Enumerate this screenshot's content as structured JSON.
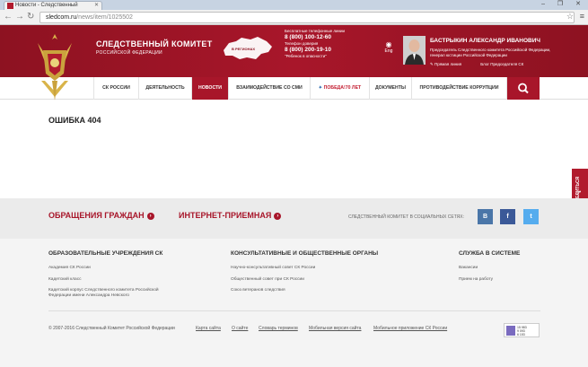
{
  "browser": {
    "tab_title": "Новости - Следственный",
    "url_host": "sledcom.ru",
    "url_path": "/news/item/1025502",
    "window_controls": "– ❐ ✕"
  },
  "header": {
    "title": "СЛЕДСТВЕННЫЙ КОМИТЕТ",
    "subtitle": "РОССИЙСКОЙ ФЕДЕРАЦИИ",
    "map_label": "В РЕГИОНАХ",
    "phones": {
      "caption1": "Бесплатные телефонные линии",
      "num1": "8 (800) 100-12-60",
      "caption2": "Телефон доверия",
      "num2": "8 (800) 200-19-10",
      "caption3": "\"Ребенок в опасности\""
    },
    "lang": "Eng",
    "person": {
      "name": "БАСТРЫКИН АЛЕКСАНДР ИВАНОВИЧ",
      "role": "Председатель Следственного комитета Российской Федерации, генерал юстиции Российской Федерации",
      "link1": "Прямая линия",
      "link2": "Блог Председателя СК"
    }
  },
  "nav": {
    "items": [
      "СК РОССИИ",
      "ДЕЯТЕЛЬНОСТЬ",
      "НОВОСТИ",
      "ВЗАИМОДЕЙСТВИЕ СО СМИ",
      "ПОБЕДА!",
      "70 ЛЕТ",
      "ДОКУМЕНТЫ",
      "ПРОТИВОДЕЙСТВИЕ КОРРУПЦИИ"
    ]
  },
  "content": {
    "error": "ОШИБКА 404"
  },
  "side_tab": {
    "label": "ПОДЕЛИТЬСЯ"
  },
  "appeals": {
    "citizens": "ОБРАЩЕНИЯ ГРАЖДАН",
    "internet": "ИНТЕРНЕТ-ПРИЕМНАЯ",
    "social_label": "СЛЕДСТВЕННЫЙ КОМИТЕТ В СОЦИАЛЬНЫХ СЕТЯХ:",
    "social": [
      "В",
      "f",
      "t"
    ]
  },
  "footer": {
    "col1": {
      "title": "ОБРАЗОВАТЕЛЬНЫЕ УЧРЕЖДЕНИЯ СК",
      "links": [
        "Академия СК России",
        "Кадетский класс",
        "Кадетский корпус Следственного комитета Российской",
        "Федерации имени Александра Невского"
      ]
    },
    "col2": {
      "title": "КОНСУЛЬТАТИВНЫЕ И ОБЩЕСТВЕННЫЕ ОРГАНЫ",
      "links": [
        "Научно-консультативный совет СК России",
        "Общественный совет при СК России",
        "Союз ветеранов следствия"
      ]
    },
    "col3": {
      "title": "СЛУЖБА В СИСТЕМЕ",
      "links": [
        "Вакансии",
        "Прием на работу"
      ]
    },
    "copyright": "© 2007-2016 Следственный Комитет Российской Федерации",
    "bottom_links": [
      "Карта сайта",
      "О сайте",
      "Словарь терминов",
      "Мобильная версия сайта",
      "Мобильное приложение СК России"
    ],
    "counter": [
      "15 983",
      "9 093",
      "6 153"
    ]
  },
  "colors": {
    "brand_red": "#a8162a",
    "vk": "#4a76a8",
    "facebook": "#3b5998",
    "twitter": "#55acee"
  }
}
